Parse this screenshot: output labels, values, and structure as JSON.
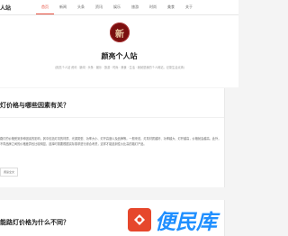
{
  "header": {
    "brand": "人站",
    "nav": [
      {
        "label": "首页",
        "active": true
      },
      {
        "label": "新闻",
        "active": false
      },
      {
        "label": "头条",
        "active": false
      },
      {
        "label": "资讯",
        "active": false
      },
      {
        "label": "娱乐",
        "active": false
      },
      {
        "label": "旅游",
        "active": false
      },
      {
        "label": "时尚",
        "active": false
      },
      {
        "label": "美食",
        "active": false
      },
      {
        "label": "关于",
        "active": false
      }
    ]
  },
  "hero": {
    "logo_text": "新",
    "site_title": "颜亮个人站",
    "site_desc": "（颜亮个人站 资讯 · 新闻 · 头条 · 娱乐 · 旅游 · 时尚 · 美食 · 生活 · 我就是我的个人网站，记录生活点滴）"
  },
  "articles": [
    {
      "title": "灯价格与哪些因素有关？",
      "excerpt": "路灯的价格受到多种因素的影响，其中包括灯具的材质、光源类型、功率大小、灯杆高度以及品牌等。一般来说，灯具材质越好、功率越大、灯杆越高，价格就会越高。此外，不同品牌之间的价格差异也比较明显，选择时需要根据实际需求进行综合考虑，这样才能选到性价比高的路灯产品。",
      "read_more": "阅读全文"
    },
    {
      "title": "能路灯价格为什么不同？",
      "excerpt": "",
      "read_more": ""
    }
  ],
  "watermark": {
    "text": "便民库"
  },
  "colors": {
    "accent": "#e74c3c",
    "watermark_blue": "#1f8fff",
    "watermark_red": "#e6472c"
  }
}
